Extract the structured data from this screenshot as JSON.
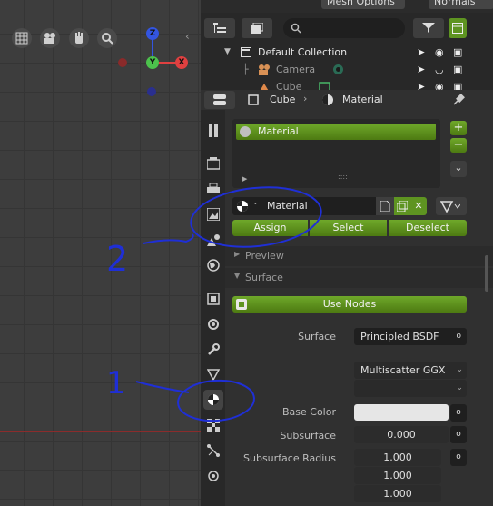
{
  "topbar": {
    "mesh_options": "Mesh Options",
    "normals": "Normals"
  },
  "outliner": {
    "search_placeholder": "",
    "rows": [
      {
        "label": "Default Collection"
      },
      {
        "label": "Camera"
      },
      {
        "label": "Cube"
      }
    ]
  },
  "properties_header": {
    "object": "Cube",
    "sep": "›",
    "material": "Material"
  },
  "material_slots": {
    "items": [
      "Material"
    ],
    "dots": "::::",
    "plus": "+",
    "minus": "−"
  },
  "material_selector": {
    "name": "Material"
  },
  "assign_row": {
    "assign": "Assign",
    "select": "Select",
    "deselect": "Deselect"
  },
  "sections": {
    "preview": "Preview",
    "surface": "Surface"
  },
  "surface": {
    "use_nodes": "Use Nodes",
    "surface_label": "Surface",
    "surface_value": "Principled BSDF",
    "distribution": "Multiscatter GGX",
    "subsurface_method": "",
    "base_color_label": "Base Color",
    "base_color_hex": "#e6e6e6",
    "subsurface_label": "Subsurface",
    "subsurface_value": "0.000",
    "radius_label": "Subsurface Radius",
    "radius_values": [
      "1.000",
      "1.000",
      "1.000"
    ]
  },
  "gizmo": {
    "z": "Z",
    "y": "Y",
    "x": "X"
  },
  "annotations": {
    "label_1": "1",
    "label_2": "2"
  },
  "colors": {
    "accent_green": "#5e9421",
    "annotation_blue": "#1f2fd6",
    "axis_x": "#e04040",
    "axis_y": "#4cc24c",
    "axis_z": "#3355e0"
  }
}
